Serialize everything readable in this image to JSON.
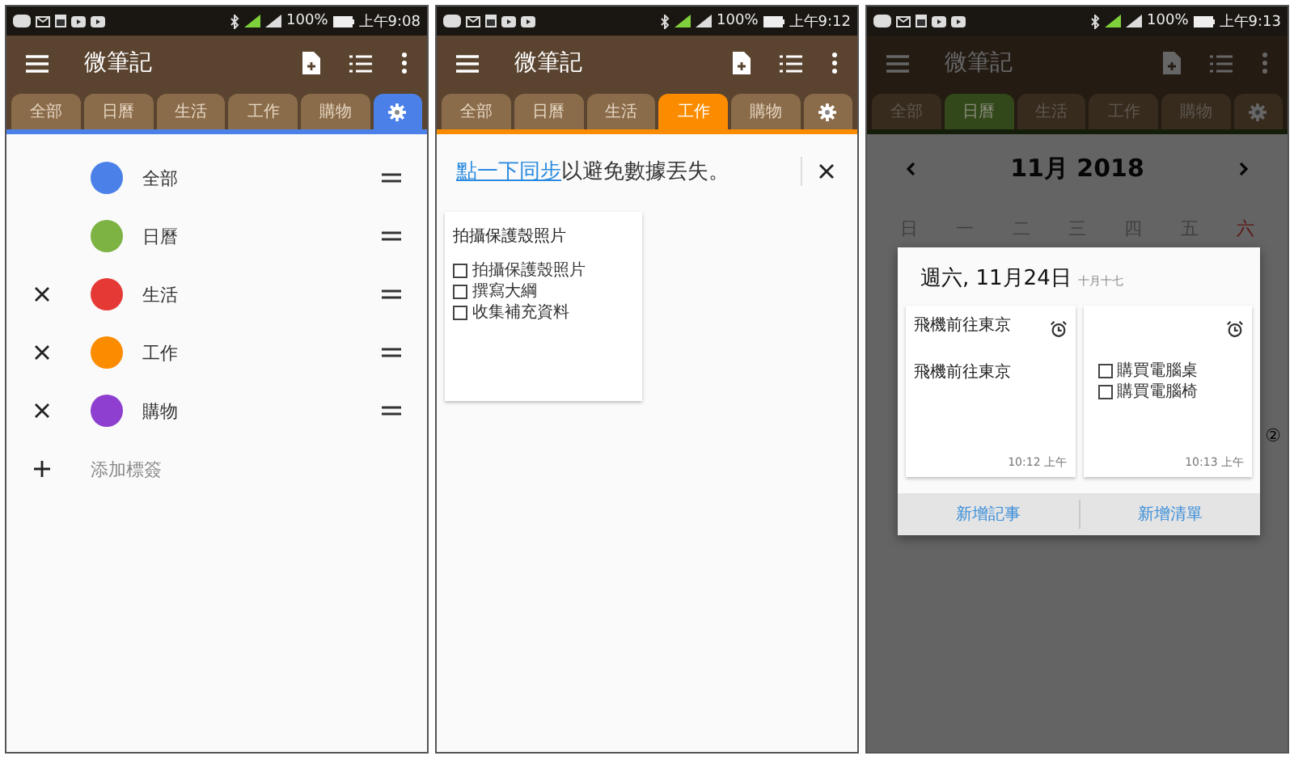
{
  "phones": [
    {
      "status_bar": {
        "battery": "100%",
        "time": "上午9:08"
      },
      "app_bar": {
        "title": "微筆記"
      },
      "tabs": [
        {
          "kind": "label",
          "label": "全部",
          "selected": false
        },
        {
          "kind": "label",
          "label": "日曆",
          "selected": false
        },
        {
          "kind": "label",
          "label": "生活",
          "selected": false
        },
        {
          "kind": "label",
          "label": "工作",
          "selected": false
        },
        {
          "kind": "label",
          "label": "購物",
          "selected": false
        },
        {
          "kind": "settings",
          "color": "#4a80e8",
          "selected": true
        }
      ],
      "screen": {
        "kind": "labels",
        "labels": [
          {
            "name": "全部",
            "color": "#4a80e8",
            "deletable": false
          },
          {
            "name": "日曆",
            "color": "#7cb342",
            "deletable": false
          },
          {
            "name": "生活",
            "color": "#e53935",
            "deletable": true
          },
          {
            "name": "工作",
            "color": "#fb8c00",
            "deletable": true
          },
          {
            "name": "購物",
            "color": "#8e3fd0",
            "deletable": true
          }
        ],
        "add_label": "添加標簽"
      }
    },
    {
      "status_bar": {
        "battery": "100%",
        "time": "上午9:12"
      },
      "app_bar": {
        "title": "微筆記"
      },
      "tabs": [
        {
          "kind": "label",
          "label": "全部",
          "selected": false
        },
        {
          "kind": "label",
          "label": "日曆",
          "selected": false
        },
        {
          "kind": "label",
          "label": "生活",
          "selected": false
        },
        {
          "kind": "label",
          "label": "工作",
          "color": "#fb8c00",
          "selected": true
        },
        {
          "kind": "label",
          "label": "購物",
          "selected": false
        },
        {
          "kind": "settings",
          "selected": false
        }
      ],
      "screen": {
        "kind": "notes",
        "banner": {
          "link": "點一下同步",
          "text": "以避免數據丟失。"
        },
        "notes": [
          {
            "title": "拍攝保護殼照片",
            "items": [
              {
                "text": "拍攝保護殼照片",
                "checked": false
              },
              {
                "text": "撰寫大綱",
                "checked": false
              },
              {
                "text": "收集補充資料",
                "checked": false
              }
            ]
          }
        ]
      }
    },
    {
      "status_bar": {
        "battery": "100%",
        "time": "上午9:13"
      },
      "app_bar": {
        "title": "微筆記"
      },
      "tabs": [
        {
          "kind": "label",
          "label": "全部",
          "selected": false
        },
        {
          "kind": "label",
          "label": "日曆",
          "color": "#32481a",
          "selected": true
        },
        {
          "kind": "label",
          "label": "生活",
          "selected": false
        },
        {
          "kind": "label",
          "label": "工作",
          "selected": false
        },
        {
          "kind": "label",
          "label": "購物",
          "selected": false
        },
        {
          "kind": "settings",
          "selected": false
        }
      ],
      "screen": {
        "kind": "calendar",
        "dimmed": true,
        "month": "11月 2018",
        "weekdays": [
          {
            "label": "日",
            "highlighted": false
          },
          {
            "label": "一",
            "highlighted": false
          },
          {
            "label": "二",
            "highlighted": false
          },
          {
            "label": "三",
            "highlighted": false
          },
          {
            "label": "四",
            "highlighted": false
          },
          {
            "label": "五",
            "highlighted": false
          },
          {
            "label": "六",
            "highlighted": true
          }
        ],
        "badge": "②",
        "dialog": {
          "date": "週六, 11月24日",
          "lunar": "十月十七",
          "notes": [
            {
              "title": "飛機前往東京",
              "body": "飛機前往東京",
              "time": "10:12 上午",
              "alarm": true
            },
            {
              "items": [
                {
                  "text": "購買電腦桌",
                  "checked": false
                },
                {
                  "text": "購買電腦椅",
                  "checked": false
                }
              ],
              "time": "10:13 上午",
              "alarm": true
            }
          ],
          "buttons": [
            "新增記事",
            "新增清單"
          ]
        }
      }
    }
  ]
}
